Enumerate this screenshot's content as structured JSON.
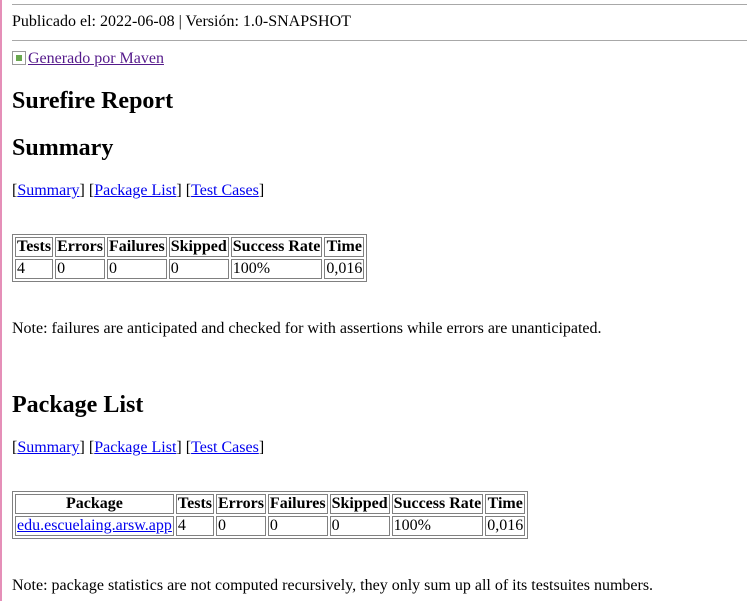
{
  "header": {
    "published_line": "Publicado el: 2022-06-08 | Versión: 1.0-SNAPSHOT",
    "maven_logo_alt": "Generado por Maven"
  },
  "title": "Surefire Report",
  "summary": {
    "heading": "Summary",
    "nav": {
      "summary": "Summary",
      "package_list": "Package List",
      "test_cases": "Test Cases"
    },
    "columns": [
      "Tests",
      "Errors",
      "Failures",
      "Skipped",
      "Success Rate",
      "Time"
    ],
    "row": [
      "4",
      "0",
      "0",
      "0",
      "100%",
      "0,016"
    ],
    "note": "Note: failures are anticipated and checked for with assertions while errors are unanticipated."
  },
  "package_list": {
    "heading": "Package List",
    "nav": {
      "summary": "Summary",
      "package_list": "Package List",
      "test_cases": "Test Cases"
    },
    "columns": [
      "Package",
      "Tests",
      "Errors",
      "Failures",
      "Skipped",
      "Success Rate",
      "Time"
    ],
    "rows": [
      [
        "edu.escuelaing.arsw.app",
        "4",
        "0",
        "0",
        "0",
        "100%",
        "0,016"
      ]
    ],
    "note": "Note: package statistics are not computed recursively, they only sum up all of its testsuites numbers."
  },
  "colors": {
    "link": "#0000ee",
    "visited_link": "#551a8b",
    "rule": "#a8a8a8",
    "left_bar": "#e58fb8"
  }
}
